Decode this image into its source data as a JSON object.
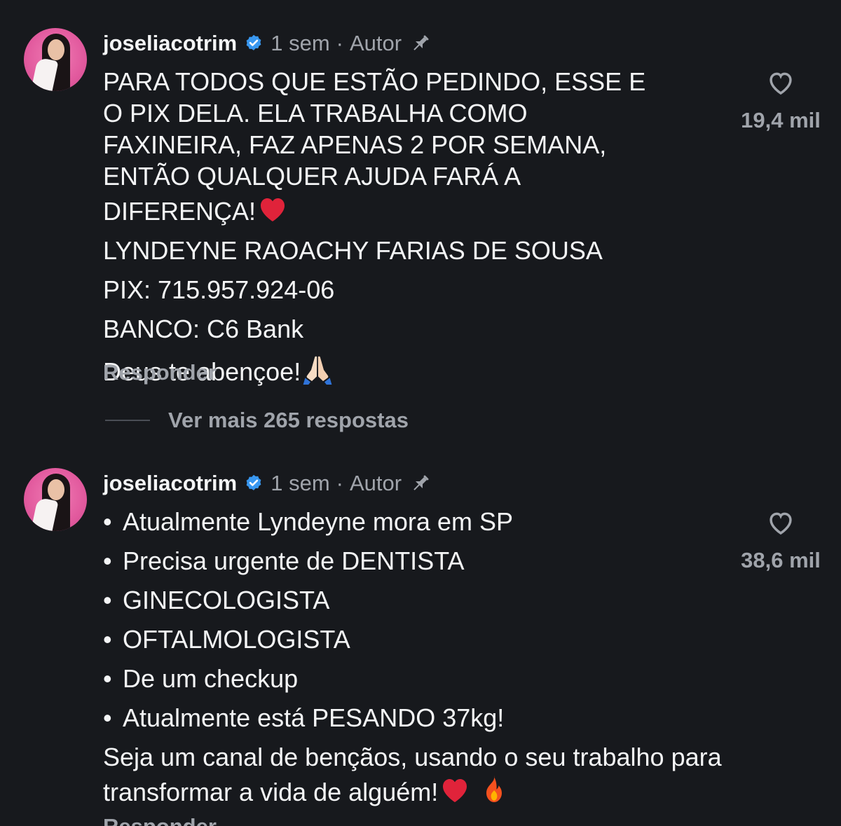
{
  "comments": [
    {
      "username": "joseliacotrim",
      "time": "1 sem",
      "separator": "·",
      "author_label": "Autor",
      "text_lines": [
        "PARA TODOS QUE ESTÃO PEDINDO, ESSE E O PIX DELA. ELA TRABALHA COMO FAXINEIRA, FAZ APENAS 2 POR SEMANA, ENTÃO QUALQUER AJUDA FARÁ A DIFERENÇA!",
        "LYNDEYNE RAOACHY FARIAS DE SOUSA",
        "PIX: 715.957.924-06",
        "BANCO: C6 Bank",
        "Deus te abençoe!"
      ],
      "reply_label": "Responder",
      "more_replies": "Ver mais 265 respostas",
      "likes": "19,4 mil",
      "icons": [
        "verified-badge-icon",
        "pin-icon",
        "heart-emoji",
        "praying-hands-emoji",
        "heart-outline-icon"
      ]
    },
    {
      "username": "joseliacotrim",
      "time": "1 sem",
      "separator": "·",
      "author_label": "Autor",
      "bullet_char": "•",
      "bullets": [
        "Atualmente Lyndeyne mora em SP",
        "Precisa urgente de DENTISTA",
        "GINECOLOGISTA",
        "OFTALMOLOGISTA",
        "De um checkup",
        "Atualmente está PESANDO 37kg!"
      ],
      "closing": "Seja um canal de bençãos, usando o seu trabalho para transformar a vida de alguém!",
      "reply_label": "Responder",
      "likes": "38,6 mil",
      "icons": [
        "verified-badge-icon",
        "pin-icon",
        "heart-emoji",
        "fire-emoji",
        "heart-outline-icon"
      ]
    }
  ],
  "colors": {
    "background": "#17191d",
    "text": "#f4f5f6",
    "secondary": "#a0a4ab",
    "verified": "#3897f0",
    "avatar": "#e25a9e"
  }
}
